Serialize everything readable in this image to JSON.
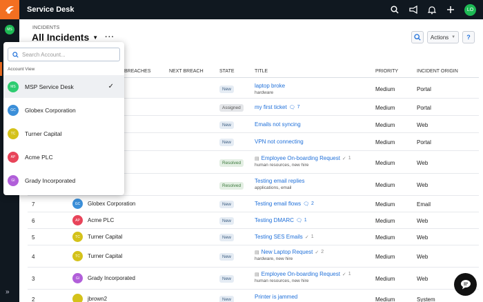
{
  "app": {
    "title": "Service Desk",
    "user_initials": "LO",
    "rail_initials": "MS"
  },
  "header": {
    "breadcrumb": "INCIDENTS",
    "title": "All Incidents",
    "actions_label": "Actions",
    "help_label": "?"
  },
  "table": {
    "columns": {
      "breaches": "BREACHES",
      "next_breach": "NEXT BREACH",
      "state": "STATE",
      "title": "TITLE",
      "priority": "PRIORITY",
      "origin": "INCIDENT ORIGIN"
    },
    "rows": [
      {
        "state": "New",
        "title": "laptop broke",
        "sub": "hardware",
        "priority": "Medium",
        "origin": "Portal"
      },
      {
        "state": "Assigned",
        "title": "my first ticket",
        "chat_count": "7",
        "priority": "Medium",
        "origin": "Portal"
      },
      {
        "state": "New",
        "title": "Emails not syncing",
        "priority": "Medium",
        "origin": "Web"
      },
      {
        "state": "New",
        "title": "VPN not connecting",
        "priority": "Medium",
        "origin": "Portal"
      },
      {
        "state": "Resolved",
        "title": "Employee On-boarding Request",
        "check_count": "1",
        "sub": "human resources, new hire",
        "priority": "Medium",
        "origin": "Web"
      },
      {
        "state": "Resolved",
        "title": "Testing email replies",
        "sub": "applications, email",
        "priority": "Medium",
        "origin": "Web"
      },
      {
        "num": "7",
        "account": "Globex Corporation",
        "initials": "GC",
        "state": "New",
        "title": "Testing email flows",
        "chat_count": "2",
        "priority": "Medium",
        "origin": "Email"
      },
      {
        "num": "6",
        "account": "Acme PLC",
        "initials": "AP",
        "state": "New",
        "title": "Testing DMARC",
        "chat_count": "1",
        "priority": "Medium",
        "origin": "Web"
      },
      {
        "num": "5",
        "account": "Turner Capital",
        "initials": "TC",
        "state": "New",
        "title": "Testing SES Emails",
        "check_count": "1",
        "priority": "Medium",
        "origin": "Web"
      },
      {
        "num": "4",
        "account": "Turner Capital",
        "initials": "TC",
        "state": "New",
        "title": "New Laptop Request",
        "check_count": "2",
        "sub": "hardware, new hire",
        "priority": "Medium",
        "origin": "Web"
      },
      {
        "num": "3",
        "account": "Grady Incorporated",
        "initials": "GI",
        "state": "New",
        "title": "Employee On-boarding Request",
        "check_count": "1",
        "sub": "human resources, new hire",
        "priority": "Medium",
        "origin": "Web"
      },
      {
        "num": "2",
        "account": "jbrown2",
        "state": "New",
        "title": "Printer is jammed",
        "priority": "Medium",
        "origin": "System"
      }
    ]
  },
  "dropdown": {
    "placeholder": "Search Account...",
    "section": "Account View",
    "items": [
      {
        "initials": "MS",
        "label": "MSP Service Desk",
        "color": "#2ecc71",
        "selected": true
      },
      {
        "initials": "GC",
        "label": "Globex Corporation",
        "color": "#3b8fd9"
      },
      {
        "initials": "TC",
        "label": "Turner Capital",
        "color": "#d4c21a"
      },
      {
        "initials": "AP",
        "label": "Acme PLC",
        "color": "#e8445a"
      },
      {
        "initials": "GI",
        "label": "Grady Incorporated",
        "color": "#b15fd9"
      }
    ]
  },
  "colors": {
    "topbar": "#101820",
    "brand": "#f36f21",
    "link": "#1e6fd9"
  }
}
